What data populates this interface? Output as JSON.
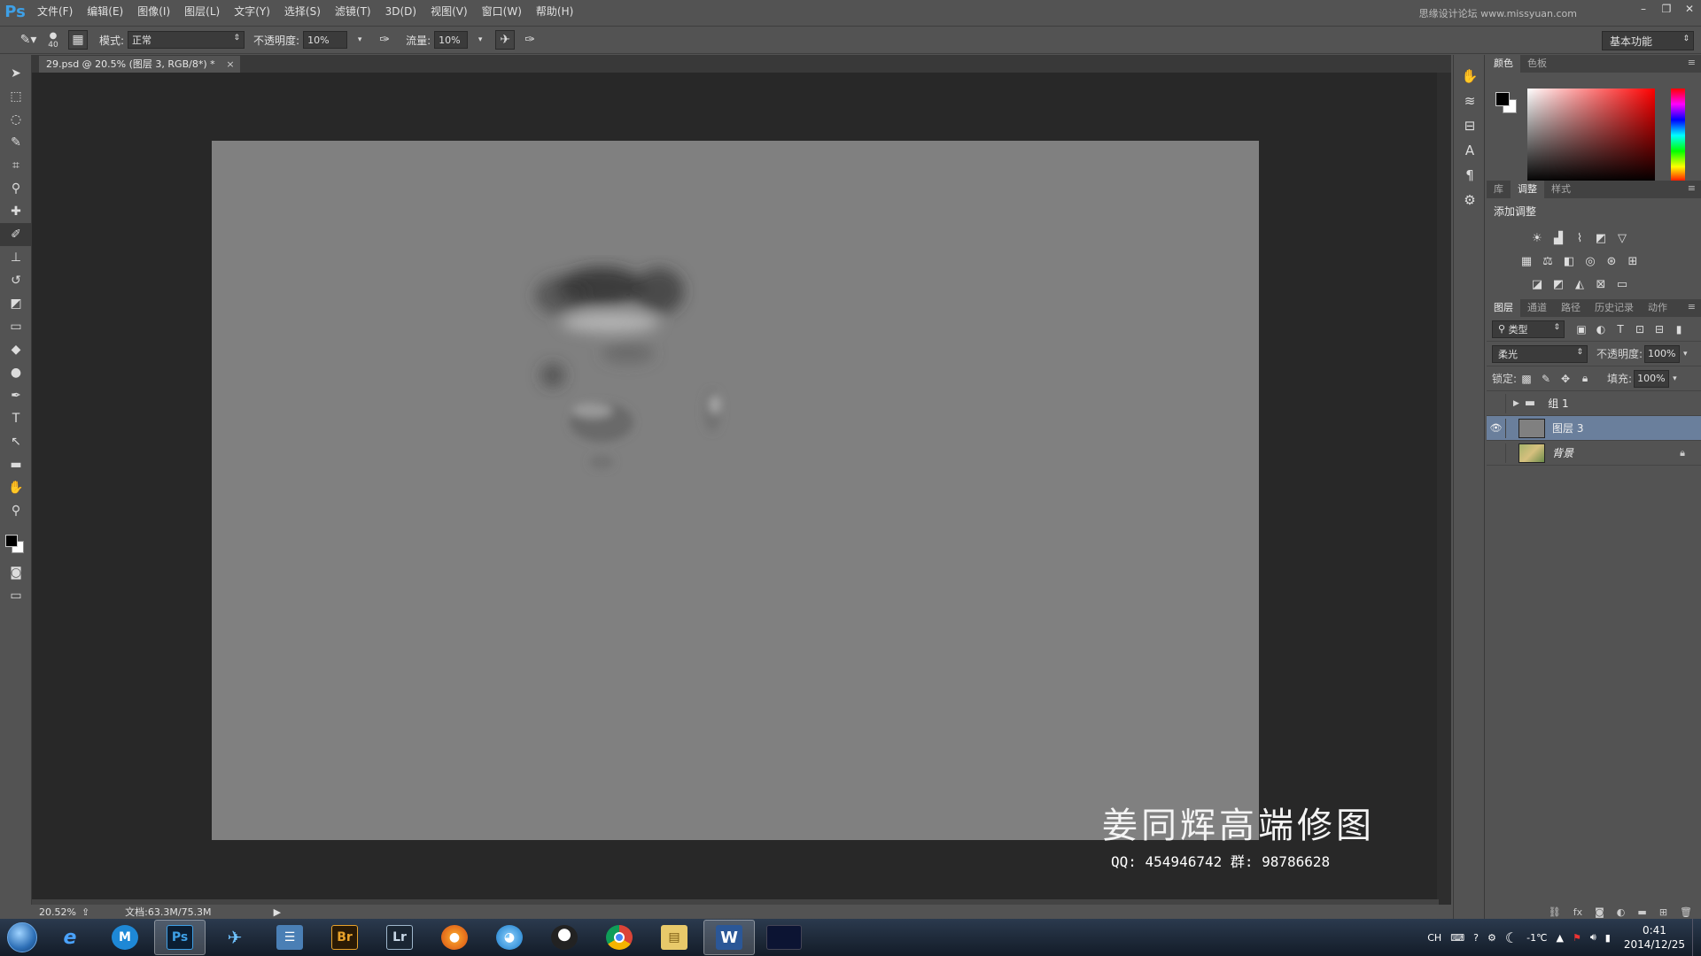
{
  "app": {
    "logo": "Ps",
    "title_watermark": "思缘设计论坛 www.missyuan.com"
  },
  "menu": [
    "文件(F)",
    "编辑(E)",
    "图像(I)",
    "图层(L)",
    "文字(Y)",
    "选择(S)",
    "滤镜(T)",
    "3D(D)",
    "视图(V)",
    "窗口(W)",
    "帮助(H)"
  ],
  "options": {
    "brush_size": "40",
    "mode_label": "模式:",
    "mode_value": "正常",
    "opacity_label": "不透明度:",
    "opacity_value": "10%",
    "flow_label": "流量:",
    "flow_value": "10%",
    "workspace": "基本功能"
  },
  "document": {
    "tab_title": "29.psd @ 20.5% (图层 3, RGB/8*) *",
    "zoom": "20.52%",
    "doc_info": "文档:63.3M/75.3M"
  },
  "watermark": {
    "title": "姜同辉高端修图",
    "contact": "QQ: 454946742  群: 98786628"
  },
  "color_panel": {
    "tabs": [
      "颜色",
      "色板"
    ]
  },
  "adjust_panel": {
    "tabs": [
      "库",
      "调整",
      "样式"
    ],
    "title": "添加调整"
  },
  "layers_panel": {
    "tabs": [
      "图层",
      "通道",
      "路径",
      "历史记录",
      "动作"
    ],
    "filter": "类型",
    "blend_mode": "柔光",
    "opacity_label": "不透明度:",
    "opacity_value": "100%",
    "lock_label": "锁定:",
    "fill_label": "填充:",
    "fill_value": "100%",
    "layers": [
      {
        "name": "组 1",
        "type": "group",
        "visible": false,
        "selected": false
      },
      {
        "name": "图层 3",
        "type": "layer",
        "visible": true,
        "selected": true
      },
      {
        "name": "背景",
        "type": "background",
        "visible": false,
        "selected": false
      }
    ]
  },
  "taskbar": {
    "apps": [
      "ie",
      "maxthon",
      "Ps",
      "feiq",
      "explorer-files",
      "Br",
      "Lr",
      "firefox",
      "im-bird",
      "QQ",
      "chrome",
      "folder",
      "W",
      "media"
    ],
    "tray": {
      "lang": "CH",
      "temp": "-1℃",
      "time": "0:41",
      "date": "2014/12/25"
    }
  }
}
